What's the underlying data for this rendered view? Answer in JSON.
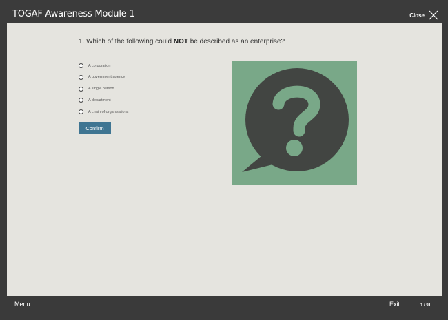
{
  "header": {
    "title": "TOGAF Awareness Module 1",
    "close_label": "Close"
  },
  "question": {
    "prefix": "1. Which of the following could ",
    "emphasis": "NOT",
    "suffix": " be described as an enterprise?",
    "options": [
      {
        "label": "A corporation"
      },
      {
        "label": "A government agency"
      },
      {
        "label": "A single person"
      },
      {
        "label": "A department"
      },
      {
        "label": "A chain of organisations"
      }
    ],
    "confirm_label": "Confirm"
  },
  "illustration": {
    "icon": "question-speech-bubble-icon",
    "background_color": "#79a888",
    "bubble_color": "#424542"
  },
  "footer": {
    "menu_label": "Menu",
    "exit_label": "Exit",
    "page_counter": "1 / 91"
  },
  "colors": {
    "chrome": "#3a3a3a",
    "content_bg": "#e5e4df",
    "accent": "#3f7592"
  }
}
